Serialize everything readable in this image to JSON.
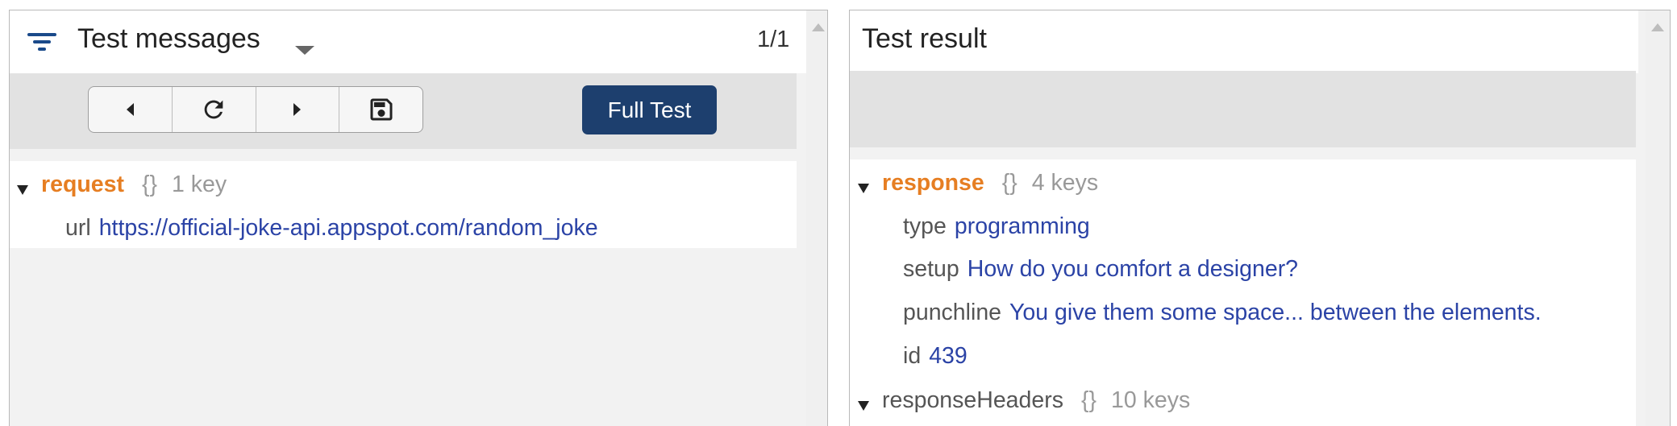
{
  "left_panel": {
    "title": "Test messages",
    "counter": "1/1",
    "full_test_label": "Full Test",
    "tree": {
      "root_key": "request",
      "root_braces": "{}",
      "root_count": "1 key",
      "props": [
        {
          "key": "url",
          "value": "https://official-joke-api.appspot.com/random_joke"
        }
      ]
    }
  },
  "right_panel": {
    "title": "Test result",
    "tree": {
      "response": {
        "key": "response",
        "braces": "{}",
        "count": "4 keys",
        "props": [
          {
            "key": "type",
            "value": "programming"
          },
          {
            "key": "setup",
            "value": "How do you comfort a designer?"
          },
          {
            "key": "punchline",
            "value": "You give them some space... between the elements."
          },
          {
            "key": "id",
            "value": "439"
          }
        ]
      },
      "response_headers": {
        "key": "responseHeaders",
        "braces": "{}",
        "count": "10 keys"
      }
    }
  },
  "colors": {
    "accent_button": "#1d3f6e",
    "key_highlight": "#e67e22",
    "value_text": "#2b43a6",
    "filter_icon": "#1a4a8a"
  },
  "icons": [
    "filter-icon",
    "dropdown-caret-icon",
    "previous-icon",
    "refresh-icon",
    "next-icon",
    "save-icon",
    "scroll-up-icon",
    "expand-caret-icon"
  ]
}
